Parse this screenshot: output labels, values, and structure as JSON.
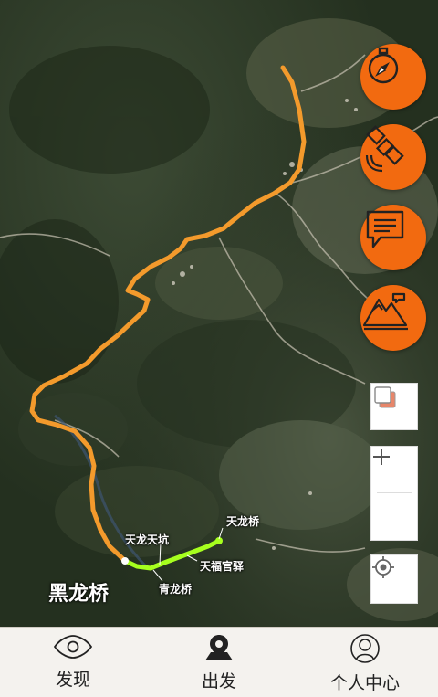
{
  "map": {
    "labels": {
      "tianlong_bridge": "天龙桥",
      "tianlong_tiankeng": "天龙天坑",
      "tianfu_guanyi": "天福官驿",
      "qinglong_bridge": "青龙桥",
      "heilong_bridge": "黑龙桥"
    },
    "route_color": "#f39a2c",
    "highlight_color": "#a6ff1e"
  },
  "side_buttons": {
    "color": "#f26a10",
    "icons": [
      "compass-icon",
      "satellite-icon",
      "chat-icon",
      "mountain-icon"
    ]
  },
  "tabbar": {
    "tabs": [
      {
        "label": "发现",
        "icon": "eye-icon"
      },
      {
        "label": "出发",
        "icon": "map-pin-icon"
      },
      {
        "label": "个人中心",
        "icon": "user-icon"
      }
    ]
  }
}
